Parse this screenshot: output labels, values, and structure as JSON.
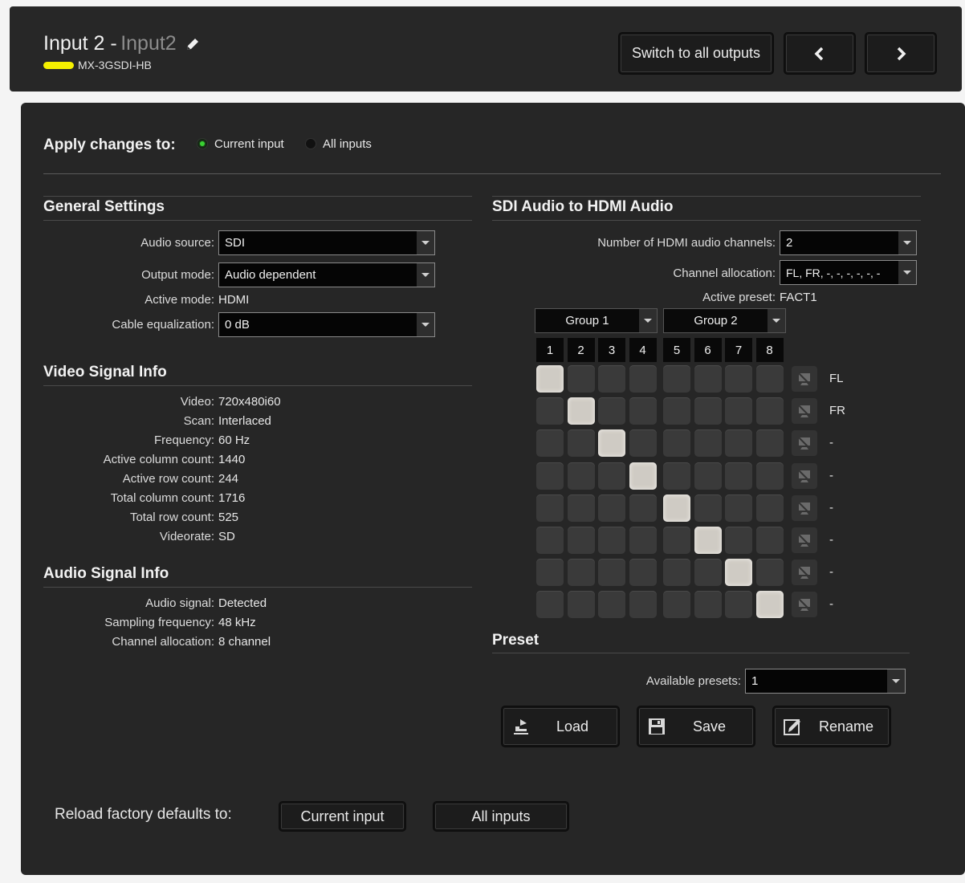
{
  "header": {
    "input_label": "Input 2 -",
    "input_name": "Input2",
    "edit_icon": "pencil-icon",
    "device_color": "#f5f000",
    "device_model": "MX-3GSDI-HB",
    "switch_all_label": "Switch to all outputs",
    "prev_icon": "chevron-left-icon",
    "next_icon": "chevron-right-icon"
  },
  "apply": {
    "label": "Apply changes to:",
    "options": [
      "Current input",
      "All inputs"
    ],
    "selected": "Current input"
  },
  "general": {
    "title": "General Settings",
    "audio_source_label": "Audio source:",
    "audio_source_value": "SDI",
    "output_mode_label": "Output mode:",
    "output_mode_value": "Audio dependent",
    "active_mode_label": "Active mode:",
    "active_mode_value": "HDMI",
    "cable_eq_label": "Cable equalization:",
    "cable_eq_value": "0 dB"
  },
  "video_info": {
    "title": "Video Signal Info",
    "rows": [
      {
        "label": "Video:",
        "value": "720x480i60"
      },
      {
        "label": "Scan:",
        "value": "Interlaced"
      },
      {
        "label": "Frequency:",
        "value": "60 Hz"
      },
      {
        "label": "Active column count:",
        "value": "1440"
      },
      {
        "label": "Active row count:",
        "value": "244"
      },
      {
        "label": "Total column count:",
        "value": "1716"
      },
      {
        "label": "Total row count:",
        "value": "525"
      },
      {
        "label": "Videorate:",
        "value": "SD"
      }
    ]
  },
  "audio_info": {
    "title": "Audio Signal Info",
    "rows": [
      {
        "label": "Audio signal:",
        "value": "Detected"
      },
      {
        "label": "Sampling frequency:",
        "value": "48 kHz"
      },
      {
        "label": "Channel allocation:",
        "value": "8 channel"
      }
    ]
  },
  "sdi_hdmi": {
    "title": "SDI Audio to HDMI Audio",
    "num_channels_label": "Number of HDMI audio channels:",
    "num_channels_value": "2",
    "channel_alloc_label": "Channel allocation:",
    "channel_alloc_value": "FL, FR, -, -, -, -, -, -",
    "active_preset_label": "Active preset:",
    "active_preset_value": "FACT1",
    "group1_label": "Group 1",
    "group2_label": "Group 2",
    "columns": [
      "1",
      "2",
      "3",
      "4",
      "5",
      "6",
      "7",
      "8"
    ],
    "row_labels": [
      "FL",
      "FR",
      "-",
      "-",
      "-",
      "-",
      "-",
      "-"
    ],
    "mute_icon": "speaker-mute-icon",
    "routing": [
      1,
      2,
      3,
      4,
      5,
      6,
      7,
      8
    ]
  },
  "preset": {
    "title": "Preset",
    "available_label": "Available presets:",
    "available_value": "1",
    "load_label": "Load",
    "save_label": "Save",
    "rename_label": "Rename",
    "load_icon": "load-icon",
    "save_icon": "floppy-disk-icon",
    "rename_icon": "rename-pencil-icon"
  },
  "reload": {
    "label": "Reload factory defaults to:",
    "current_label": "Current input",
    "all_label": "All inputs"
  }
}
